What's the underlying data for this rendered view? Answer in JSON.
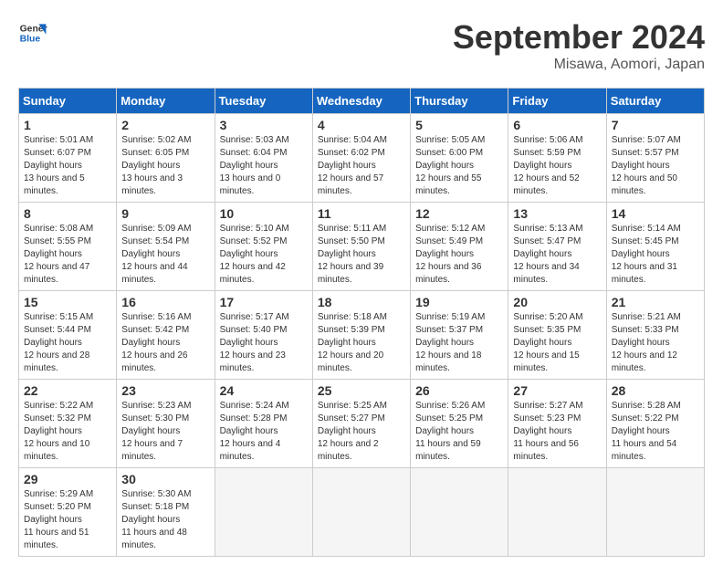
{
  "header": {
    "logo_text_general": "General",
    "logo_text_blue": "Blue",
    "month": "September 2024",
    "location": "Misawa, Aomori, Japan"
  },
  "days_of_week": [
    "Sunday",
    "Monday",
    "Tuesday",
    "Wednesday",
    "Thursday",
    "Friday",
    "Saturday"
  ],
  "weeks": [
    [
      {
        "day": "1",
        "sunrise": "5:01 AM",
        "sunset": "6:07 PM",
        "daylight": "13 hours and 5 minutes."
      },
      {
        "day": "2",
        "sunrise": "5:02 AM",
        "sunset": "6:05 PM",
        "daylight": "13 hours and 3 minutes."
      },
      {
        "day": "3",
        "sunrise": "5:03 AM",
        "sunset": "6:04 PM",
        "daylight": "13 hours and 0 minutes."
      },
      {
        "day": "4",
        "sunrise": "5:04 AM",
        "sunset": "6:02 PM",
        "daylight": "12 hours and 57 minutes."
      },
      {
        "day": "5",
        "sunrise": "5:05 AM",
        "sunset": "6:00 PM",
        "daylight": "12 hours and 55 minutes."
      },
      {
        "day": "6",
        "sunrise": "5:06 AM",
        "sunset": "5:59 PM",
        "daylight": "12 hours and 52 minutes."
      },
      {
        "day": "7",
        "sunrise": "5:07 AM",
        "sunset": "5:57 PM",
        "daylight": "12 hours and 50 minutes."
      }
    ],
    [
      {
        "day": "8",
        "sunrise": "5:08 AM",
        "sunset": "5:55 PM",
        "daylight": "12 hours and 47 minutes."
      },
      {
        "day": "9",
        "sunrise": "5:09 AM",
        "sunset": "5:54 PM",
        "daylight": "12 hours and 44 minutes."
      },
      {
        "day": "10",
        "sunrise": "5:10 AM",
        "sunset": "5:52 PM",
        "daylight": "12 hours and 42 minutes."
      },
      {
        "day": "11",
        "sunrise": "5:11 AM",
        "sunset": "5:50 PM",
        "daylight": "12 hours and 39 minutes."
      },
      {
        "day": "12",
        "sunrise": "5:12 AM",
        "sunset": "5:49 PM",
        "daylight": "12 hours and 36 minutes."
      },
      {
        "day": "13",
        "sunrise": "5:13 AM",
        "sunset": "5:47 PM",
        "daylight": "12 hours and 34 minutes."
      },
      {
        "day": "14",
        "sunrise": "5:14 AM",
        "sunset": "5:45 PM",
        "daylight": "12 hours and 31 minutes."
      }
    ],
    [
      {
        "day": "15",
        "sunrise": "5:15 AM",
        "sunset": "5:44 PM",
        "daylight": "12 hours and 28 minutes."
      },
      {
        "day": "16",
        "sunrise": "5:16 AM",
        "sunset": "5:42 PM",
        "daylight": "12 hours and 26 minutes."
      },
      {
        "day": "17",
        "sunrise": "5:17 AM",
        "sunset": "5:40 PM",
        "daylight": "12 hours and 23 minutes."
      },
      {
        "day": "18",
        "sunrise": "5:18 AM",
        "sunset": "5:39 PM",
        "daylight": "12 hours and 20 minutes."
      },
      {
        "day": "19",
        "sunrise": "5:19 AM",
        "sunset": "5:37 PM",
        "daylight": "12 hours and 18 minutes."
      },
      {
        "day": "20",
        "sunrise": "5:20 AM",
        "sunset": "5:35 PM",
        "daylight": "12 hours and 15 minutes."
      },
      {
        "day": "21",
        "sunrise": "5:21 AM",
        "sunset": "5:33 PM",
        "daylight": "12 hours and 12 minutes."
      }
    ],
    [
      {
        "day": "22",
        "sunrise": "5:22 AM",
        "sunset": "5:32 PM",
        "daylight": "12 hours and 10 minutes."
      },
      {
        "day": "23",
        "sunrise": "5:23 AM",
        "sunset": "5:30 PM",
        "daylight": "12 hours and 7 minutes."
      },
      {
        "day": "24",
        "sunrise": "5:24 AM",
        "sunset": "5:28 PM",
        "daylight": "12 hours and 4 minutes."
      },
      {
        "day": "25",
        "sunrise": "5:25 AM",
        "sunset": "5:27 PM",
        "daylight": "12 hours and 2 minutes."
      },
      {
        "day": "26",
        "sunrise": "5:26 AM",
        "sunset": "5:25 PM",
        "daylight": "11 hours and 59 minutes."
      },
      {
        "day": "27",
        "sunrise": "5:27 AM",
        "sunset": "5:23 PM",
        "daylight": "11 hours and 56 minutes."
      },
      {
        "day": "28",
        "sunrise": "5:28 AM",
        "sunset": "5:22 PM",
        "daylight": "11 hours and 54 minutes."
      }
    ],
    [
      {
        "day": "29",
        "sunrise": "5:29 AM",
        "sunset": "5:20 PM",
        "daylight": "11 hours and 51 minutes."
      },
      {
        "day": "30",
        "sunrise": "5:30 AM",
        "sunset": "5:18 PM",
        "daylight": "11 hours and 48 minutes."
      },
      null,
      null,
      null,
      null,
      null
    ]
  ]
}
